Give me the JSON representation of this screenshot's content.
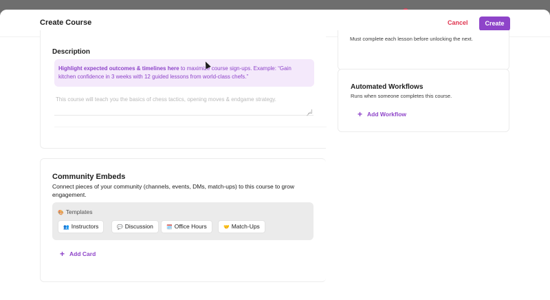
{
  "header": {
    "title": "Create Course",
    "cancel_label": "Cancel",
    "create_label": "Create"
  },
  "description": {
    "title": "Description",
    "hint_bold": "Highlight expected outcomes & timelines here",
    "hint_rest": " to maximize course sign-ups. Example: “Gain kitchen confidence in 3 weeks with 12 guided lessons from world-class chefs.”",
    "placeholder": "This course will teach you the basics of chess tactics, opening moves & endgame strategy."
  },
  "community_embeds": {
    "title": "Community Embeds",
    "description": "Connect pieces of your community (channels, events, DMs, match-ups) to this course to grow engagement.",
    "templates_label": "Templates",
    "templates_icon": "🎨",
    "chips": [
      {
        "icon": "👥",
        "label": "Instructors"
      },
      {
        "icon": "💬",
        "label": "Discussion"
      },
      {
        "icon": "🗓️",
        "label": "Office Hours"
      },
      {
        "icon": "🤝",
        "label": "Match-Ups"
      }
    ],
    "add_card_label": "Add Card"
  },
  "lesson_setting": {
    "note": "Must complete each lesson before unlocking the next."
  },
  "workflows": {
    "title": "Automated Workflows",
    "subtitle": "Runs when someone completes this course.",
    "add_label": "Add Workflow"
  },
  "colors": {
    "accent": "#8e44c9",
    "cancel": "#e0344f",
    "hint_bg": "#f4e9fb"
  }
}
